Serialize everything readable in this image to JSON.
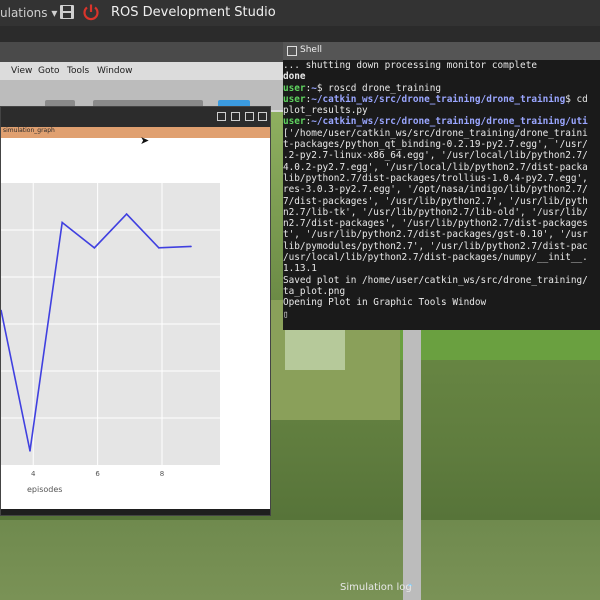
{
  "app": {
    "menu_label": "ulations",
    "menu_caret": "▾",
    "title": "ROS Development Studio"
  },
  "background_window": {
    "menu": [
      "View",
      "Goto",
      "Tools",
      "Window"
    ]
  },
  "plot_window": {
    "subtitle": "simulation_graph",
    "x_label": "episodes",
    "x_ticks": [
      "4",
      "6",
      "8"
    ]
  },
  "chart_data": {
    "type": "line",
    "xlabel": "episodes",
    "x": [
      3.9,
      4.9,
      5.9,
      6.9,
      7.9,
      8.9
    ],
    "y": [
      0.05,
      0.86,
      0.77,
      0.89,
      0.77,
      0.775
    ],
    "xlim": [
      3.0,
      9.8
    ],
    "ylim": [
      0,
      1
    ],
    "grid": true,
    "line_color": "#4040e0"
  },
  "shell": {
    "title": "Shell",
    "lines": [
      {
        "parts": [
          {
            "c": "w",
            "t": "... shutting down processing monitor complete"
          }
        ]
      },
      {
        "parts": [
          {
            "c": "w bold",
            "t": "done"
          }
        ]
      },
      {
        "parts": [
          {
            "c": "g bold",
            "t": "user"
          },
          {
            "c": "w",
            "t": ":"
          },
          {
            "c": "b bold",
            "t": "~"
          },
          {
            "c": "w",
            "t": "$ roscd drone_training"
          }
        ]
      },
      {
        "parts": [
          {
            "c": "g bold",
            "t": "user"
          },
          {
            "c": "w",
            "t": ":"
          },
          {
            "c": "b bold",
            "t": "~/catkin_ws/src/drone_training/drone_training"
          },
          {
            "c": "w",
            "t": "$ cd"
          }
        ]
      },
      {
        "parts": [
          {
            "c": "w",
            "t": "plot_results.py"
          }
        ]
      },
      {
        "parts": [
          {
            "c": "g bold",
            "t": "user"
          },
          {
            "c": "w",
            "t": ":"
          },
          {
            "c": "b bold",
            "t": "~/catkin_ws/src/drone_training/drone_training/uti"
          }
        ]
      },
      {
        "parts": [
          {
            "c": "w",
            "t": "['/home/user/catkin_ws/src/drone_training/drone_traini"
          }
        ]
      },
      {
        "parts": [
          {
            "c": "w",
            "t": "t-packages/python_qt_binding-0.2.19-py2.7.egg', '/usr/"
          }
        ]
      },
      {
        "parts": [
          {
            "c": "w",
            "t": ".2-py2.7-linux-x86_64.egg', '/usr/local/lib/python2.7/"
          }
        ]
      },
      {
        "parts": [
          {
            "c": "w",
            "t": "4.0.2-py2.7.egg', '/usr/local/lib/python2.7/dist-packa"
          }
        ]
      },
      {
        "parts": [
          {
            "c": "w",
            "t": "lib/python2.7/dist-packages/trollius-1.0.4-py2.7.egg',"
          }
        ]
      },
      {
        "parts": [
          {
            "c": "w",
            "t": "res-3.0.3-py2.7.egg', '/opt/nasa/indigo/lib/python2.7/"
          }
        ]
      },
      {
        "parts": [
          {
            "c": "w",
            "t": "7/dist-packages', '/usr/lib/python2.7', '/usr/lib/pyth"
          }
        ]
      },
      {
        "parts": [
          {
            "c": "w",
            "t": "n2.7/lib-tk', '/usr/lib/python2.7/lib-old', '/usr/lib/"
          }
        ]
      },
      {
        "parts": [
          {
            "c": "w",
            "t": "n2.7/dist-packages', '/usr/lib/python2.7/dist-packages"
          }
        ]
      },
      {
        "parts": [
          {
            "c": "w",
            "t": "t', '/usr/lib/python2.7/dist-packages/gst-0.10', '/usr"
          }
        ]
      },
      {
        "parts": [
          {
            "c": "w",
            "t": "lib/pymodules/python2.7', '/usr/lib/python2.7/dist-pac"
          }
        ]
      },
      {
        "parts": [
          {
            "c": "w",
            "t": "/usr/local/lib/python2.7/dist-packages/numpy/__init__."
          }
        ]
      },
      {
        "parts": [
          {
            "c": "w",
            "t": "1.13.1"
          }
        ]
      },
      {
        "parts": [
          {
            "c": "w",
            "t": "Saved plot in /home/user/catkin_ws/src/drone_training/"
          }
        ]
      },
      {
        "parts": [
          {
            "c": "w",
            "t": "ta_plot.png"
          }
        ]
      },
      {
        "parts": [
          {
            "c": "w",
            "t": "Opening Plot in Graphic Tools Window"
          }
        ]
      },
      {
        "parts": [
          {
            "c": "w",
            "t": "▯"
          }
        ]
      }
    ]
  },
  "footer": {
    "sim_log_label": "Simulation log",
    "sim_log_arrow": "⌃"
  },
  "colors": {
    "topbar": "#333333",
    "prompt_user": "#5fd35f",
    "prompt_path": "#9aa6ff",
    "power_red": "#d9342b"
  }
}
